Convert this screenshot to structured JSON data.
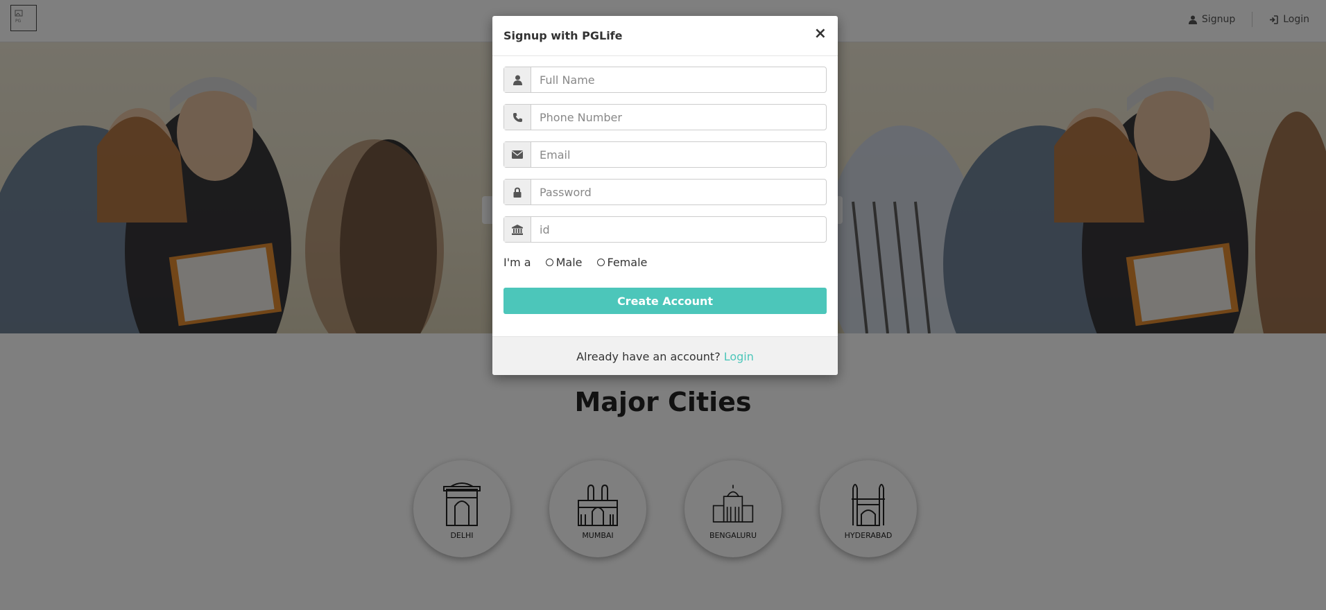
{
  "navbar": {
    "logo_icon": "logo-icon",
    "links": [
      {
        "label": "Signup",
        "icon": "user-icon"
      },
      {
        "label": "Login",
        "icon": "sign-in-icon"
      }
    ]
  },
  "cities": {
    "title": "Major Cities",
    "items": [
      {
        "name": "DELHI",
        "icon": "india-gate-icon"
      },
      {
        "name": "MUMBAI",
        "icon": "gateway-of-india-icon"
      },
      {
        "name": "BENGALURU",
        "icon": "vidhana-soudha-icon"
      },
      {
        "name": "HYDERABAD",
        "icon": "charminar-icon"
      }
    ]
  },
  "modal": {
    "title": "Signup with PGLife",
    "close_label": "×",
    "fields": {
      "full_name": {
        "placeholder": "Full Name",
        "value": "",
        "icon": "user-icon"
      },
      "phone": {
        "placeholder": "Phone Number",
        "value": "",
        "icon": "phone-icon"
      },
      "email": {
        "placeholder": "Email",
        "value": "",
        "icon": "envelope-icon"
      },
      "password": {
        "placeholder": "Password",
        "value": "",
        "icon": "lock-icon"
      },
      "id": {
        "placeholder": "id",
        "value": "",
        "icon": "bank-icon"
      }
    },
    "gender": {
      "label": "I'm a",
      "options": [
        "Male",
        "Female"
      ]
    },
    "submit_label": "Create Account",
    "footer_text": "Already have an account?",
    "footer_link": "Login"
  },
  "colors": {
    "accent": "#4cc6ba",
    "overlay": "rgba(0,0,0,0.5)"
  }
}
